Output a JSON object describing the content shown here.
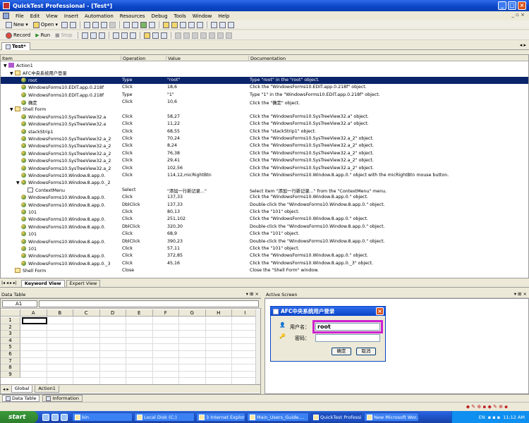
{
  "window": {
    "title": "QuickTest Professional - [Test*]"
  },
  "menu": [
    "File",
    "Edit",
    "View",
    "Insert",
    "Automation",
    "Resources",
    "Debug",
    "Tools",
    "Window",
    "Help"
  ],
  "toolbar": {
    "new_label": "New",
    "open_label": "Open",
    "record_label": "Record",
    "run_label": "Run",
    "stop_label": "Stop"
  },
  "doc_tab": {
    "label": "Test*"
  },
  "grid": {
    "headers": [
      "Item",
      "Operation",
      "Value",
      "Documentation"
    ],
    "rows": [
      {
        "indent": 0,
        "exp": "▼",
        "icon": "act",
        "item": "Action1",
        "op": "",
        "val": "",
        "doc": ""
      },
      {
        "indent": 1,
        "exp": "▼",
        "icon": "win",
        "item": "AFC中央系统用户登录",
        "op": "",
        "val": "",
        "doc": ""
      },
      {
        "indent": 2,
        "exp": "",
        "icon": "obj",
        "item": "root",
        "op": "Type",
        "val": "\"root\"",
        "doc": "Type \"root\" in the \"root\" object.",
        "sel": true
      },
      {
        "indent": 2,
        "exp": "",
        "icon": "obj",
        "item": "WindowsForms10.EDIT.app.0.218f",
        "op": "Click",
        "val": "18,6",
        "doc": "Click the \"WindowsForms10.EDIT.app.0.218f\" object."
      },
      {
        "indent": 2,
        "exp": "",
        "icon": "obj",
        "item": "WindowsForms10.EDIT.app.0.218f",
        "op": "Type",
        "val": "\"1\"",
        "doc": "Type \"1\" in the \"WindowsForms10.EDIT.app.0.218f\" object."
      },
      {
        "indent": 2,
        "exp": "",
        "icon": "obj",
        "item": "确定",
        "op": "Click",
        "val": "10,6",
        "doc": "Click the \"确定\" object."
      },
      {
        "indent": 1,
        "exp": "▼",
        "icon": "win",
        "item": "Shell Form",
        "op": "",
        "val": "",
        "doc": ""
      },
      {
        "indent": 2,
        "exp": "",
        "icon": "obj",
        "item": "WindowsForms10.SysTreeView32.a",
        "op": "Click",
        "val": "58,27",
        "doc": "Click the \"WindowsForms10.SysTreeView32.a\" object."
      },
      {
        "indent": 2,
        "exp": "",
        "icon": "obj",
        "item": "WindowsForms10.SysTreeView32.a",
        "op": "Click",
        "val": "11,22",
        "doc": "Click the \"WindowsForms10.SysTreeView32.a\" object."
      },
      {
        "indent": 2,
        "exp": "",
        "icon": "obj",
        "item": "stackStrip1",
        "op": "Click",
        "val": "68,55",
        "doc": "Click the \"stackStrip1\" object."
      },
      {
        "indent": 2,
        "exp": "",
        "icon": "obj",
        "item": "WindowsForms10.SysTreeView32.a_2",
        "op": "Click",
        "val": "70,24",
        "doc": "Click the \"WindowsForms10.SysTreeView32.a_2\" object."
      },
      {
        "indent": 2,
        "exp": "",
        "icon": "obj",
        "item": "WindowsForms10.SysTreeView32.a_2",
        "op": "Click",
        "val": "8,24",
        "doc": "Click the \"WindowsForms10.SysTreeView32.a_2\" object."
      },
      {
        "indent": 2,
        "exp": "",
        "icon": "obj",
        "item": "WindowsForms10.SysTreeView32.a_2",
        "op": "Click",
        "val": "76,38",
        "doc": "Click the \"WindowsForms10.SysTreeView32.a_2\" object."
      },
      {
        "indent": 2,
        "exp": "",
        "icon": "obj",
        "item": "WindowsForms10.SysTreeView32.a_2",
        "op": "Click",
        "val": "29,41",
        "doc": "Click the \"WindowsForms10.SysTreeView32.a_2\" object."
      },
      {
        "indent": 2,
        "exp": "",
        "icon": "obj",
        "item": "WindowsForms10.SysTreeView32.a_2",
        "op": "Click",
        "val": "102,56",
        "doc": "Click the \"WindowsForms10.SysTreeView32.a_2\" object."
      },
      {
        "indent": 2,
        "exp": "",
        "icon": "obj",
        "item": "WindowsForms10.Window.8.app.0.",
        "op": "Click",
        "val": "114,12,micRightBtn",
        "doc": "Click the \"WindowsForms10.Window.8.app.0.\" object with the micRightBtn mouse button."
      },
      {
        "indent": 2,
        "exp": "▼",
        "icon": "obj",
        "item": "WindowsForms10.Window.8.app.0._2",
        "op": "",
        "val": "",
        "doc": ""
      },
      {
        "indent": 3,
        "exp": "",
        "icon": "menu",
        "item": "ContextMenu",
        "op": "Select",
        "val": "\"添加一行新记录...\"",
        "doc": "Select item \"添加一行新记录...\" from the \"ContextMenu\" menu."
      },
      {
        "indent": 2,
        "exp": "",
        "icon": "obj",
        "item": "WindowsForms10.Window.8.app.0.",
        "op": "Click",
        "val": "137,33",
        "doc": "Click the \"WindowsForms10.Window.8.app.0.\" object."
      },
      {
        "indent": 2,
        "exp": "",
        "icon": "obj",
        "item": "WindowsForms10.Window.8.app.0.",
        "op": "DblClick",
        "val": "137,33",
        "doc": "Double-click the \"WindowsForms10.Window.8.app.0.\" object."
      },
      {
        "indent": 2,
        "exp": "",
        "icon": "obj",
        "item": "101",
        "op": "Click",
        "val": "80,13",
        "doc": "Click the \"101\" object."
      },
      {
        "indent": 2,
        "exp": "",
        "icon": "obj",
        "item": "WindowsForms10.Window.8.app.0.",
        "op": "Click",
        "val": "251,102",
        "doc": "Click the \"WindowsForms10.Window.8.app.0.\" object."
      },
      {
        "indent": 2,
        "exp": "",
        "icon": "obj",
        "item": "WindowsForms10.Window.8.app.0.",
        "op": "DblClick",
        "val": "320,30",
        "doc": "Double-click the \"WindowsForms10.Window.8.app.0.\" object."
      },
      {
        "indent": 2,
        "exp": "",
        "icon": "obj",
        "item": "101",
        "op": "Click",
        "val": "68,9",
        "doc": "Click the \"101\" object."
      },
      {
        "indent": 2,
        "exp": "",
        "icon": "obj",
        "item": "WindowsForms10.Window.8.app.0.",
        "op": "DblClick",
        "val": "390,23",
        "doc": "Double-click the \"WindowsForms10.Window.8.app.0.\" object."
      },
      {
        "indent": 2,
        "exp": "",
        "icon": "obj",
        "item": "101",
        "op": "Click",
        "val": "57,11",
        "doc": "Click the \"101\" object."
      },
      {
        "indent": 2,
        "exp": "",
        "icon": "obj",
        "item": "WindowsForms10.Window.8.app.0.",
        "op": "Click",
        "val": "372,85",
        "doc": "Click the \"WindowsForms10.Window.8.app.0.\" object."
      },
      {
        "indent": 2,
        "exp": "",
        "icon": "obj",
        "item": "WindowsForms10.Window.8.app.0._3",
        "op": "Click",
        "val": "45,16",
        "doc": "Click the \"WindowsForms10.Window.8.app.0._3\" object."
      },
      {
        "indent": 1,
        "exp": "",
        "icon": "win",
        "item": "Shell Form",
        "op": "Close",
        "val": "",
        "doc": "Close the \"Shell Form\" window."
      }
    ]
  },
  "view_tabs": {
    "keyword": "Keyword View",
    "expert": "Expert View"
  },
  "data_table": {
    "title": "Data Table",
    "cell_ref": "A1",
    "columns": [
      "A",
      "B",
      "C",
      "D",
      "E",
      "F",
      "G",
      "H",
      "I"
    ],
    "rows": [
      "1",
      "2",
      "3",
      "4",
      "5",
      "6",
      "7",
      "8",
      "9"
    ],
    "sheets": [
      "Global",
      "Action1"
    ]
  },
  "active_screen": {
    "title": "Active Screen",
    "dialog_title": "AFC中央系统用户登录",
    "user_label": "用户名：",
    "user_value": "root",
    "pass_label": "密码：",
    "ok_label": "确定",
    "cancel_label": "取消"
  },
  "bottom_tabs": {
    "data_table": "Data Table",
    "information": "Information"
  },
  "taskbar": {
    "start_label": "start",
    "tasks": [
      "bin",
      "Local Disk (C:)",
      "3 Internet Explorer",
      "Main_Users_Guide....",
      "QuickTest Professi...",
      "New Microsoft Wor..."
    ],
    "lang": "EN",
    "clock": "11:12 AM"
  }
}
